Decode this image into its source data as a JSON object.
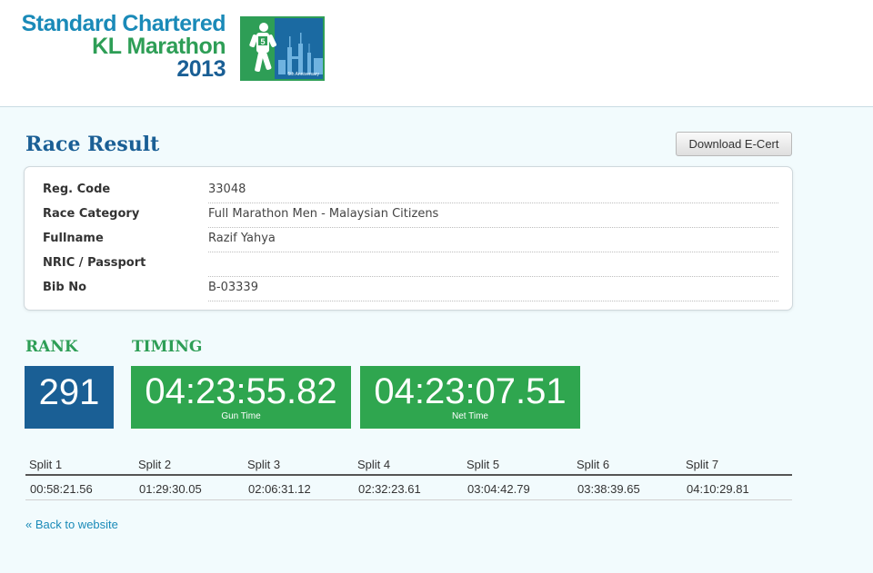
{
  "brand": {
    "line1": "Standard Chartered",
    "line2": "KL Marathon",
    "line3": "2013",
    "logo_number": "5",
    "logo_caption": "5th Anniversary",
    "colors": {
      "blue": "#1a5f95",
      "light_blue": "#1a8ab8",
      "green": "#2e9e56"
    }
  },
  "page": {
    "title": "Race Result",
    "ecert_button": "Download E-Cert"
  },
  "info": [
    {
      "label": "Reg. Code",
      "value": "33048"
    },
    {
      "label": "Race Category",
      "value": "Full Marathon Men - Malaysian Citizens"
    },
    {
      "label": "Fullname",
      "value": "Razif Yahya"
    },
    {
      "label": "NRIC / Passport",
      "value": ""
    },
    {
      "label": "Bib No",
      "value": "B-03339"
    }
  ],
  "rank": {
    "heading": "RANK",
    "value": "291"
  },
  "timing": {
    "heading": "TIMING",
    "gun_time": "04:23:55.82",
    "gun_caption": "Gun Time",
    "net_time": "04:23:07.51",
    "net_caption": "Net Time"
  },
  "splits": {
    "headers": [
      "Split 1",
      "Split 2",
      "Split 3",
      "Split 4",
      "Split 5",
      "Split 6",
      "Split 7"
    ],
    "values": [
      "00:58:21.56",
      "01:29:30.05",
      "02:06:31.12",
      "02:32:23.61",
      "03:04:42.79",
      "03:38:39.65",
      "04:10:29.81"
    ]
  },
  "back_link": "« Back to website",
  "icons": {
    "logo": "runner-skyline-logo-icon"
  }
}
